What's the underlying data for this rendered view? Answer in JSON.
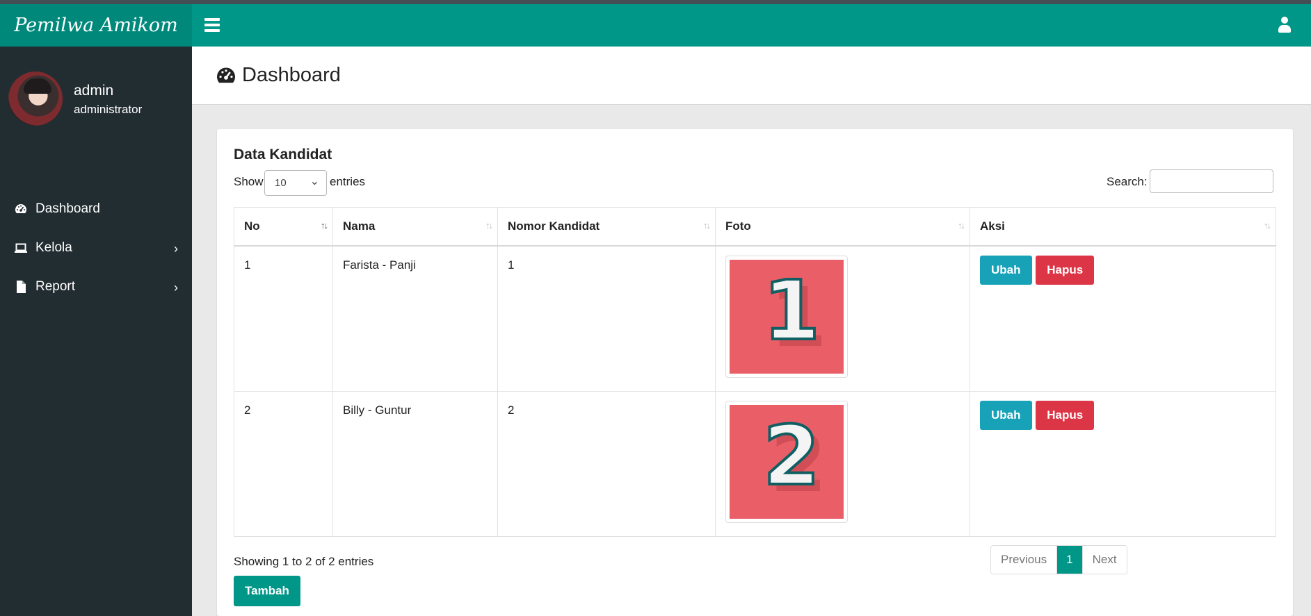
{
  "app": {
    "brand": "Pemilwa Amikom"
  },
  "user": {
    "name": "admin",
    "role": "administrator"
  },
  "sidebar": {
    "items": [
      {
        "label": "Dashboard",
        "icon": "dashboard-icon"
      },
      {
        "label": "Kelola",
        "icon": "laptop-icon",
        "has_submenu": true
      },
      {
        "label": "Report",
        "icon": "file-icon",
        "has_submenu": true
      }
    ]
  },
  "page": {
    "title": "Dashboard"
  },
  "box": {
    "title": "Data Kandidat"
  },
  "table_controls": {
    "show_label": "Show",
    "length_value": "10",
    "entries_label": "entries",
    "search_label": "Search:",
    "search_value": ""
  },
  "table": {
    "columns": [
      "No",
      "Nama",
      "Nomor Kandidat",
      "Foto",
      "Aksi"
    ],
    "rows": [
      {
        "no": "1",
        "nama": "Farista - Panji",
        "nomor": "1",
        "foto_number": "1"
      },
      {
        "no": "2",
        "nama": "Billy - Guntur",
        "nomor": "2",
        "foto_number": "2"
      }
    ],
    "edit_label": "Ubah",
    "delete_label": "Hapus"
  },
  "footer": {
    "info": "Showing 1 to 2 of 2 entries",
    "previous": "Previous",
    "current_page": "1",
    "next": "Next",
    "add_label": "Tambah"
  },
  "colors": {
    "primary": "#009688",
    "sidebar": "#222d32",
    "edit": "#17a2b8",
    "delete": "#dc3545",
    "photo_bg": "#ea5f67"
  }
}
